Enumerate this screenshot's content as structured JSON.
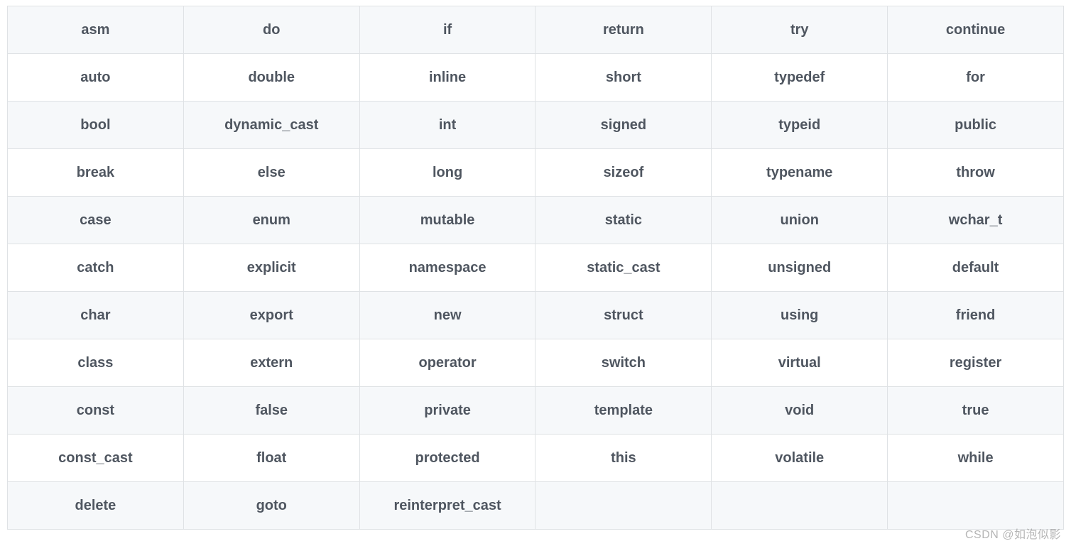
{
  "table": {
    "header": [
      "asm",
      "do",
      "if",
      "return",
      "try",
      "continue"
    ],
    "rows": [
      [
        "auto",
        "double",
        "inline",
        "short",
        "typedef",
        "for"
      ],
      [
        "bool",
        "dynamic_cast",
        "int",
        "signed",
        "typeid",
        "public"
      ],
      [
        "break",
        "else",
        "long",
        "sizeof",
        "typename",
        "throw"
      ],
      [
        "case",
        "enum",
        "mutable",
        "static",
        "union",
        "wchar_t"
      ],
      [
        "catch",
        "explicit",
        "namespace",
        "static_cast",
        "unsigned",
        "default"
      ],
      [
        "char",
        "export",
        "new",
        "struct",
        "using",
        "friend"
      ],
      [
        "class",
        "extern",
        "operator",
        "switch",
        "virtual",
        "register"
      ],
      [
        "const",
        "false",
        "private",
        "template",
        "void",
        "true"
      ],
      [
        "const_cast",
        "float",
        "protected",
        "this",
        "volatile",
        "while"
      ],
      [
        "delete",
        "goto",
        "reinterpret_cast",
        "",
        "",
        ""
      ]
    ]
  },
  "watermark": "CSDN @如泡似影"
}
